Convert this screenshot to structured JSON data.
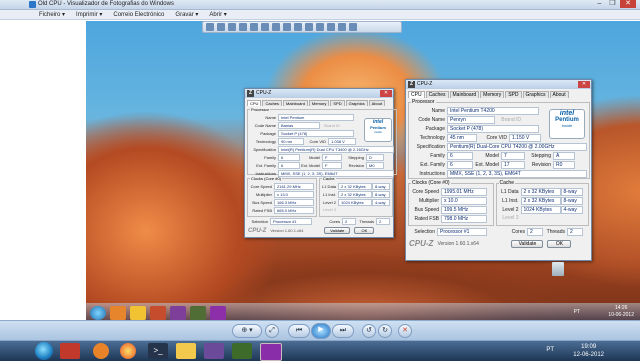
{
  "window": {
    "title": "Old CPU - Visualizador de Fotografias do Windows",
    "controls": {
      "minimize": "–",
      "maximize": "❐",
      "close": "✕"
    }
  },
  "menu": [
    "Ficheiro ▾",
    "Imprimir ▾",
    "Correio Electrónico",
    "Gravar ▾",
    "Abrir ▾"
  ],
  "cpuz_small": {
    "title": "CPU-Z",
    "tabs": [
      "CPU",
      "Caches",
      "Mainboard",
      "Memory",
      "SPD",
      "Graphics",
      "About"
    ],
    "processor_legend": "Processor",
    "name": "Intel Pentium",
    "codename": "Banias",
    "brand_id": "Brand ID",
    "package": "Socket P (478)",
    "technology": "90 nm",
    "core_vid": "1.038 V",
    "specification": "Intel(R) Pentium(R) Dual CPU T3400 @ 2.16GHz",
    "family": "6",
    "model": "F",
    "stepping": "D",
    "ext_family": "6",
    "ext_model": "F",
    "revision": "M0",
    "instructions": "MMX, SSE (1, 2, 3, 3S), EM64T",
    "clocks_legend": "Clocks (Core #0)",
    "cache_legend": "Cache",
    "core_speed": "2161.29 MHz",
    "multiplier": "x 13.0",
    "bus_speed": "166.3 MHz",
    "rated_fsb": "665.0 MHz",
    "l1_data": "2 x 32 KBytes",
    "l1_data_way": "8-way",
    "l1_inst": "2 x 32 KBytes",
    "l1_inst_way": "8-way",
    "level2": "1024 KBytes",
    "level2_way": "4-way",
    "selection": "Processor #1",
    "cores": "2",
    "threads": "2",
    "version": "Version 1.60.1.x64",
    "validate": "Validate",
    "ok": "OK",
    "intel_brand": "intel",
    "intel_product": "Pentium",
    "intel_inside": "inside"
  },
  "cpuz_big": {
    "title": "CPU-Z",
    "tabs": [
      "CPU",
      "Caches",
      "Mainboard",
      "Memory",
      "SPD",
      "Graphics",
      "About"
    ],
    "processor_legend": "Processor",
    "labels": {
      "name": "Name",
      "codename": "Code Name",
      "package": "Package",
      "technology": "Technology",
      "core_vid": "Core VID",
      "specification": "Specification",
      "family": "Family",
      "model": "Model",
      "stepping": "Stepping",
      "ext_family": "Ext. Family",
      "ext_model": "Ext. Model",
      "revision": "Revision",
      "instructions": "Instructions",
      "core_speed": "Core Speed",
      "multiplier": "Multiplier",
      "bus_speed": "Bus Speed",
      "rated_fsb": "Rated FSB",
      "l1_data": "L1 Data",
      "l1_inst": "L1 Inst.",
      "level2": "Level 2",
      "level3": "Level 3",
      "selection": "Selection",
      "cores": "Cores",
      "threads": "Threads"
    },
    "name": "Intel Pentium T4200",
    "codename": "Penryn",
    "brand_id": "Brand ID",
    "package": "Socket P (478)",
    "technology": "45 nm",
    "core_vid": "1.150 V",
    "specification": "Pentium(R) Dual-Core CPU T4200 @ 2.00GHz",
    "family": "6",
    "model": "7",
    "stepping": "A",
    "ext_family": "6",
    "ext_model": "17",
    "revision": "R0",
    "instructions": "MMX, SSE (1, 2, 3, 3S), EM64T",
    "clocks_legend": "Clocks (Core #0)",
    "cache_legend": "Cache",
    "core_speed": "1995.01 MHz",
    "multiplier": "x 10.0",
    "bus_speed": "199.5 MHz",
    "rated_fsb": "798.0 MHz",
    "l1_data": "2 x 32 KBytes",
    "l1_data_way": "8-way",
    "l1_inst": "2 x 32 KBytes",
    "l1_inst_way": "8-way",
    "level2": "1024 KBytes",
    "level2_way": "4-way",
    "selection": "Processor #1",
    "cores": "2",
    "threads": "2",
    "logo": "CPU-Z",
    "version": "Version 1.60.1.x64",
    "validate": "Validate",
    "ok": "OK",
    "intel_brand": "intel",
    "intel_product": "Pentium",
    "intel_inside": "inside"
  },
  "inner_taskbar": {
    "time": "14:26",
    "date": "10-06-2012",
    "lang": "PT"
  },
  "taskbar": {
    "time": "19:09",
    "date": "12-06-2012",
    "lang": "PT"
  },
  "colors": {
    "value_text": "#0f2e74",
    "close_red": "#c7433a",
    "taskbar": "#1d3655"
  }
}
